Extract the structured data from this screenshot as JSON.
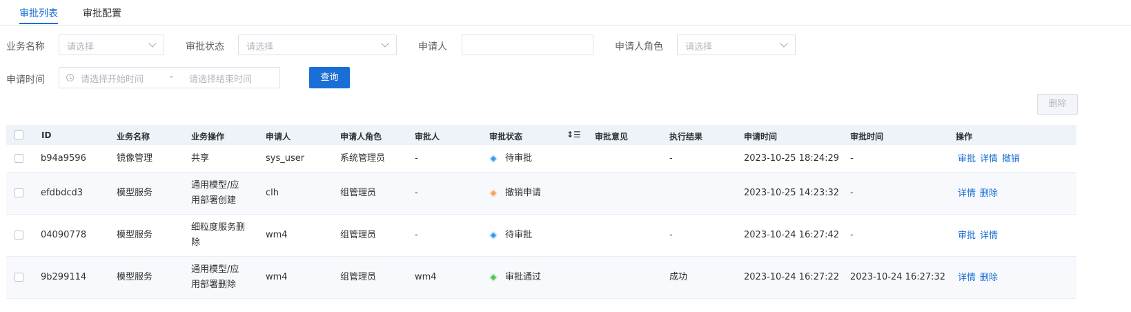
{
  "tabs": [
    {
      "label": "审批列表"
    },
    {
      "label": "审批配置"
    }
  ],
  "filters": {
    "business_name": {
      "label": "业务名称",
      "placeholder": "请选择"
    },
    "approval_status": {
      "label": "审批状态",
      "placeholder": "请选择"
    },
    "applicant": {
      "label": "申请人",
      "value": ""
    },
    "applicant_role": {
      "label": "申请人角色",
      "placeholder": "请选择"
    },
    "apply_time": {
      "label": "申请时间",
      "start_placeholder": "请选择开始时间",
      "separator": "-",
      "end_placeholder": "请选择结束时间"
    }
  },
  "buttons": {
    "query": "查询",
    "delete": "删除"
  },
  "table": {
    "columns": [
      "ID",
      "业务名称",
      "业务操作",
      "申请人",
      "申请人角色",
      "审批人",
      "审批状态",
      "审批意见",
      "执行结果",
      "申请时间",
      "审批时间",
      "操作"
    ],
    "rows": [
      {
        "id": "b94a9596",
        "business": "镜像管理",
        "op_line1": "共享",
        "op_line2": "",
        "applicant": "sys_user",
        "role": "系统管理员",
        "approver": "-",
        "status": "待审批",
        "status_color": "#3a9bf0",
        "opinion": "",
        "result": "-",
        "apply_time": "2023-10-25 18:24:29",
        "approve_time": "-",
        "actions": [
          "审批",
          "详情",
          "撤销"
        ]
      },
      {
        "id": "efdbdcd3",
        "business": "模型服务",
        "op_line1": "通用模型/应",
        "op_line2": "用部署创建",
        "applicant": "clh",
        "role": "组管理员",
        "approver": "-",
        "status": "撤销申请",
        "status_color": "#f2a65a",
        "opinion": "",
        "result": "",
        "apply_time": "2023-10-25 14:23:32",
        "approve_time": "-",
        "actions": [
          "详情",
          "删除"
        ]
      },
      {
        "id": "04090778",
        "business": "模型服务",
        "op_line1": "细粒度服务删",
        "op_line2": "除",
        "applicant": "wm4",
        "role": "组管理员",
        "approver": "-",
        "status": "待审批",
        "status_color": "#3a9bf0",
        "opinion": "",
        "result": "-",
        "apply_time": "2023-10-24 16:27:42",
        "approve_time": "-",
        "actions": [
          "审批",
          "详情"
        ]
      },
      {
        "id": "9b299114",
        "business": "模型服务",
        "op_line1": "通用模型/应",
        "op_line2": "用部署删除",
        "applicant": "wm4",
        "role": "组管理员",
        "approver": "wm4",
        "status": "审批通过",
        "status_color": "#52c45a",
        "opinion": "",
        "result": "成功",
        "apply_time": "2023-10-24 16:27:22",
        "approve_time": "2023-10-24 16:27:32",
        "actions": [
          "详情",
          "删除"
        ]
      }
    ]
  },
  "icons": {
    "sort": "sort-icon",
    "clock": "clock-icon",
    "chevron": "chevron-down-icon"
  }
}
